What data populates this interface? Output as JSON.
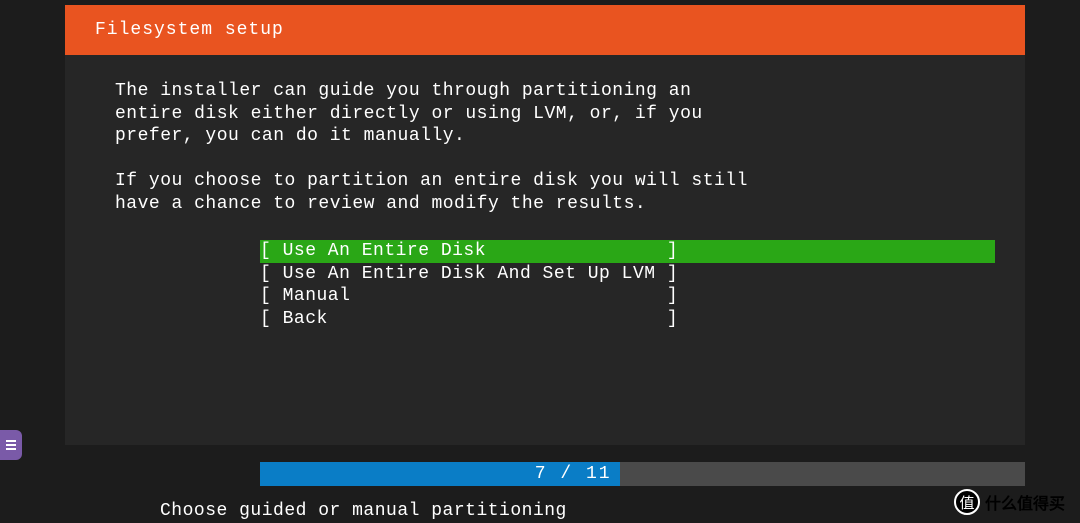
{
  "header": {
    "title": "Filesystem setup"
  },
  "description": {
    "line1": "The installer can guide you through partitioning an",
    "line2": "entire disk either directly or using LVM, or, if you",
    "line3": "prefer, you can do it manually.",
    "line4": "If you choose to partition an entire disk you will still",
    "line5": "have a chance to review and modify the results."
  },
  "menu": {
    "items": [
      {
        "label": "[ Use An Entire Disk                ]",
        "selected": true
      },
      {
        "label": "[ Use An Entire Disk And Set Up LVM ]",
        "selected": false
      },
      {
        "label": "[ Manual                            ]",
        "selected": false
      },
      {
        "label": "[ Back                              ]",
        "selected": false
      }
    ]
  },
  "progress": {
    "current": 7,
    "total": 11,
    "text": "7 / 11"
  },
  "footer": {
    "text": "Choose guided or manual partitioning"
  },
  "watermark": {
    "icon": "值",
    "text": "什么值得买"
  }
}
